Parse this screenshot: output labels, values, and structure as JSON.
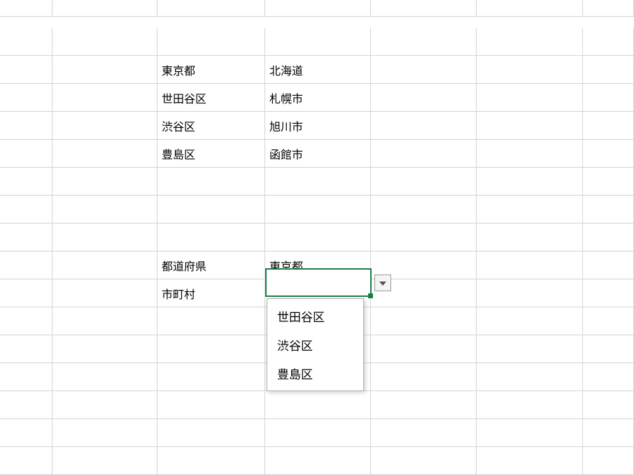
{
  "table": {
    "col1": [
      "東京都",
      "世田谷区",
      "渋谷区",
      "豊島区"
    ],
    "col2": [
      "北海道",
      "札幌市",
      "旭川市",
      "函館市"
    ]
  },
  "form": {
    "prefecture_label": "都道府県",
    "prefecture_value": "東京都",
    "city_label": "市町村",
    "city_value": ""
  },
  "dropdown": {
    "options": [
      "世田谷区",
      "渋谷区",
      "豊島区"
    ]
  }
}
